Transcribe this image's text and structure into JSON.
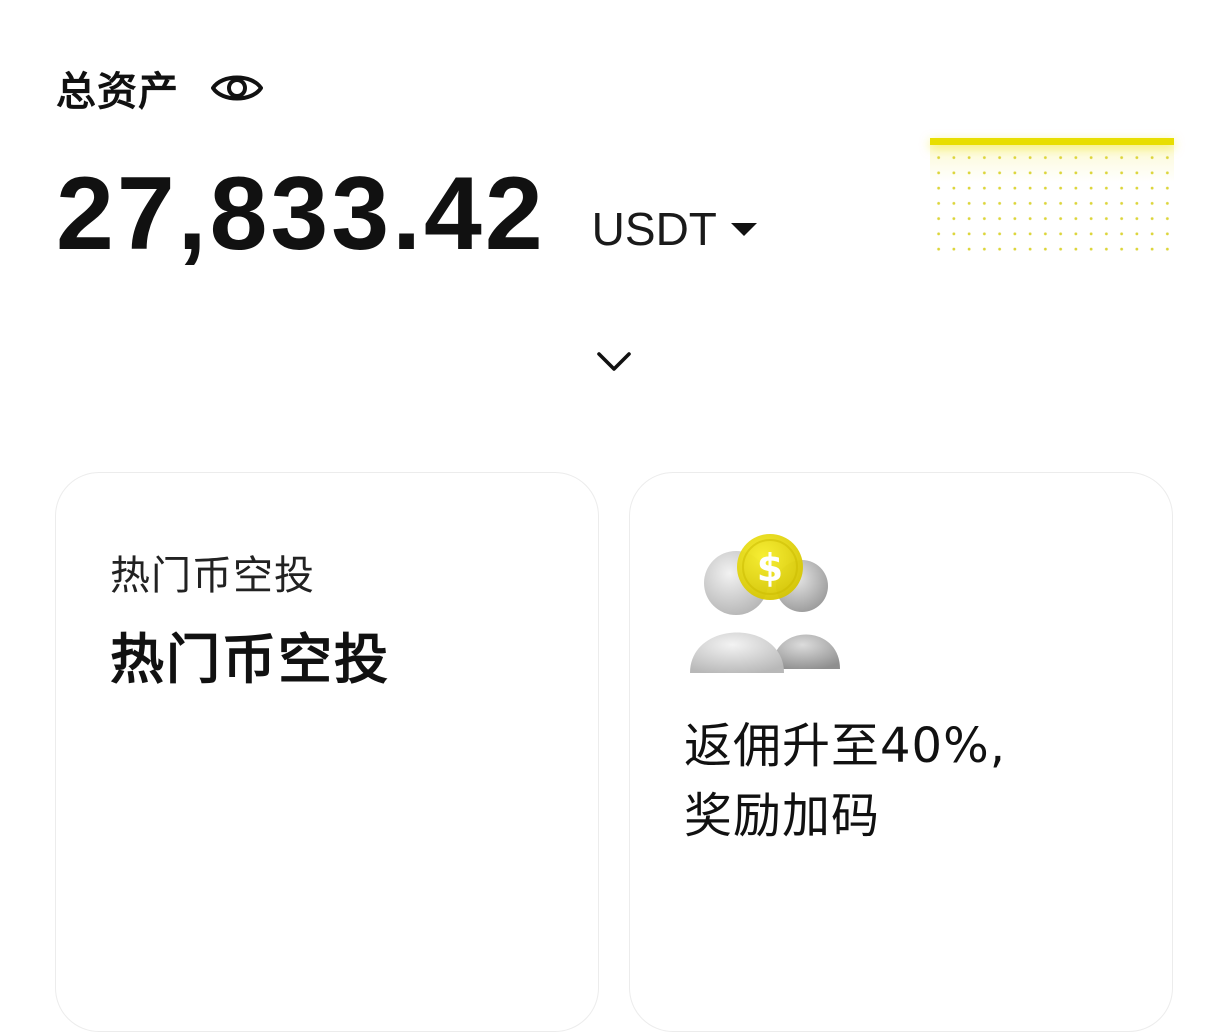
{
  "header": {
    "assets_label": "总资产",
    "visibility_icon": "eye-icon"
  },
  "balance": {
    "amount": "27,833.42",
    "currency": "USDT",
    "currency_icon": "caret-down-icon"
  },
  "expand_icon": "chevron-down-icon",
  "cards": {
    "airdrop": {
      "subtitle": "热门币空投",
      "title": "热门币空投"
    },
    "referral": {
      "illustration": "users-with-coin-icon",
      "line1": "返佣升至40%,",
      "line2": "奖励加码"
    }
  },
  "colors": {
    "accent": "#e8de00",
    "text": "#111111",
    "card_border": "#ececec"
  }
}
